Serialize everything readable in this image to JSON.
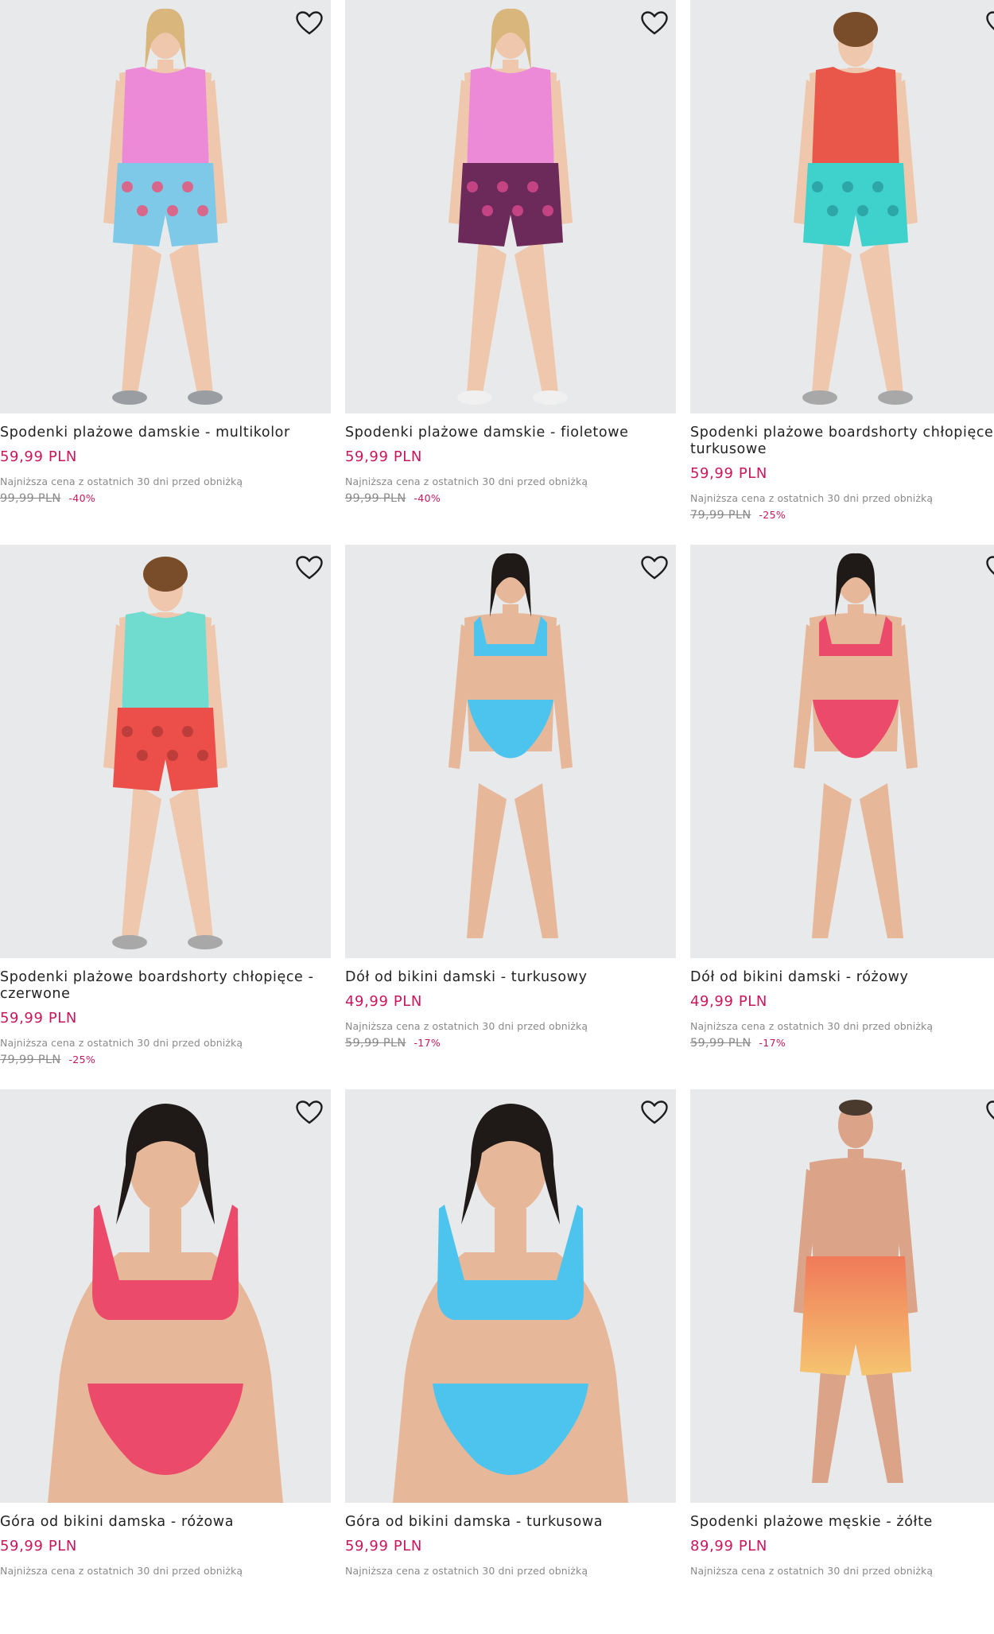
{
  "products": [
    {
      "name": "Spodenki plażowe damskie - multikolor",
      "price": "59,99 PLN",
      "lowest_label": "Najniższa cena z ostatnich 30 dni przed obniżką",
      "old_price": "99,99 PLN",
      "discount": "-40%",
      "model": "woman",
      "top_color": "#ec8ad8",
      "bottom_color": "#7ec8e8",
      "bottom_accent": "#e8577a",
      "outfit": "tank-shorts",
      "shoe_color": "#9a9ea3"
    },
    {
      "name": "Spodenki plażowe damskie - fioletowe",
      "price": "59,99 PLN",
      "lowest_label": "Najniższa cena z ostatnich 30 dni przed obniżką",
      "old_price": "99,99 PLN",
      "discount": "-40%",
      "model": "woman",
      "top_color": "#ec8ad8",
      "bottom_color": "#6b2a5a",
      "bottom_accent": "#d4488a",
      "outfit": "tank-shorts",
      "shoe_color": "#f0f0f0"
    },
    {
      "name": "Spodenki plażowe boardshorty chłopięce - turkusowe",
      "price": "59,99 PLN",
      "lowest_label": "Najniższa cena z ostatnich 30 dni przed obniżką",
      "old_price": "79,99 PLN",
      "discount": "-25%",
      "model": "boy",
      "top_color": "#e8574a",
      "bottom_color": "#3fd1cc",
      "bottom_accent": "#2a9fa0",
      "outfit": "tank-shorts",
      "shoe_color": "#a8a8a8"
    },
    {
      "name": "Spodenki plażowe boardshorty chłopięce - czerwone",
      "price": "59,99 PLN",
      "lowest_label": "Najniższa cena z ostatnich 30 dni przed obniżką",
      "old_price": "79,99 PLN",
      "discount": "-25%",
      "model": "boy",
      "top_color": "#6fdccf",
      "bottom_color": "#ec4f4a",
      "bottom_accent": "#b53a37",
      "outfit": "tank-shorts",
      "shoe_color": "#a8a8a8"
    },
    {
      "name": "Dół od bikini damski - turkusowy",
      "price": "49,99 PLN",
      "lowest_label": "Najniższa cena z ostatnich 30 dni przed obniżką",
      "old_price": "59,99 PLN",
      "discount": "-17%",
      "model": "woman-dark",
      "top_color": "#4cc4ee",
      "bottom_color": "#4cc4ee",
      "bottom_accent": "#3aa8d6",
      "outfit": "bikini",
      "shoe_color": ""
    },
    {
      "name": "Dół od bikini damski - różowy",
      "price": "49,99 PLN",
      "lowest_label": "Najniższa cena z ostatnich 30 dni przed obniżką",
      "old_price": "59,99 PLN",
      "discount": "-17%",
      "model": "woman-dark",
      "top_color": "#ec4a6a",
      "bottom_color": "#ec4a6a",
      "bottom_accent": "#cf3a58",
      "outfit": "bikini",
      "shoe_color": ""
    },
    {
      "name": "Góra od bikini damska - różowa",
      "price": "59,99 PLN",
      "lowest_label": "Najniższa cena z ostatnich 30 dni przed obniżką",
      "old_price": "",
      "discount": "",
      "model": "woman-dark",
      "top_color": "#ec4a6a",
      "bottom_color": "#ec4a6a",
      "bottom_accent": "#cf3a58",
      "outfit": "bikini-close",
      "shoe_color": ""
    },
    {
      "name": "Góra od bikini damska - turkusowa",
      "price": "59,99 PLN",
      "lowest_label": "Najniższa cena z ostatnich 30 dni przed obniżką",
      "old_price": "",
      "discount": "",
      "model": "woman-dark",
      "top_color": "#4cc4ee",
      "bottom_color": "#4cc4ee",
      "bottom_accent": "#3aa8d6",
      "outfit": "bikini-close",
      "shoe_color": ""
    },
    {
      "name": "Spodenki plażowe męskie - żółte",
      "price": "89,99 PLN",
      "lowest_label": "Najniższa cena z ostatnich 30 dni przed obniżką",
      "old_price": "",
      "discount": "",
      "model": "man",
      "top_color": "",
      "bottom_color": "#f07a5a",
      "bottom_accent": "#f5c470",
      "outfit": "shorts-only",
      "shoe_color": ""
    }
  ]
}
